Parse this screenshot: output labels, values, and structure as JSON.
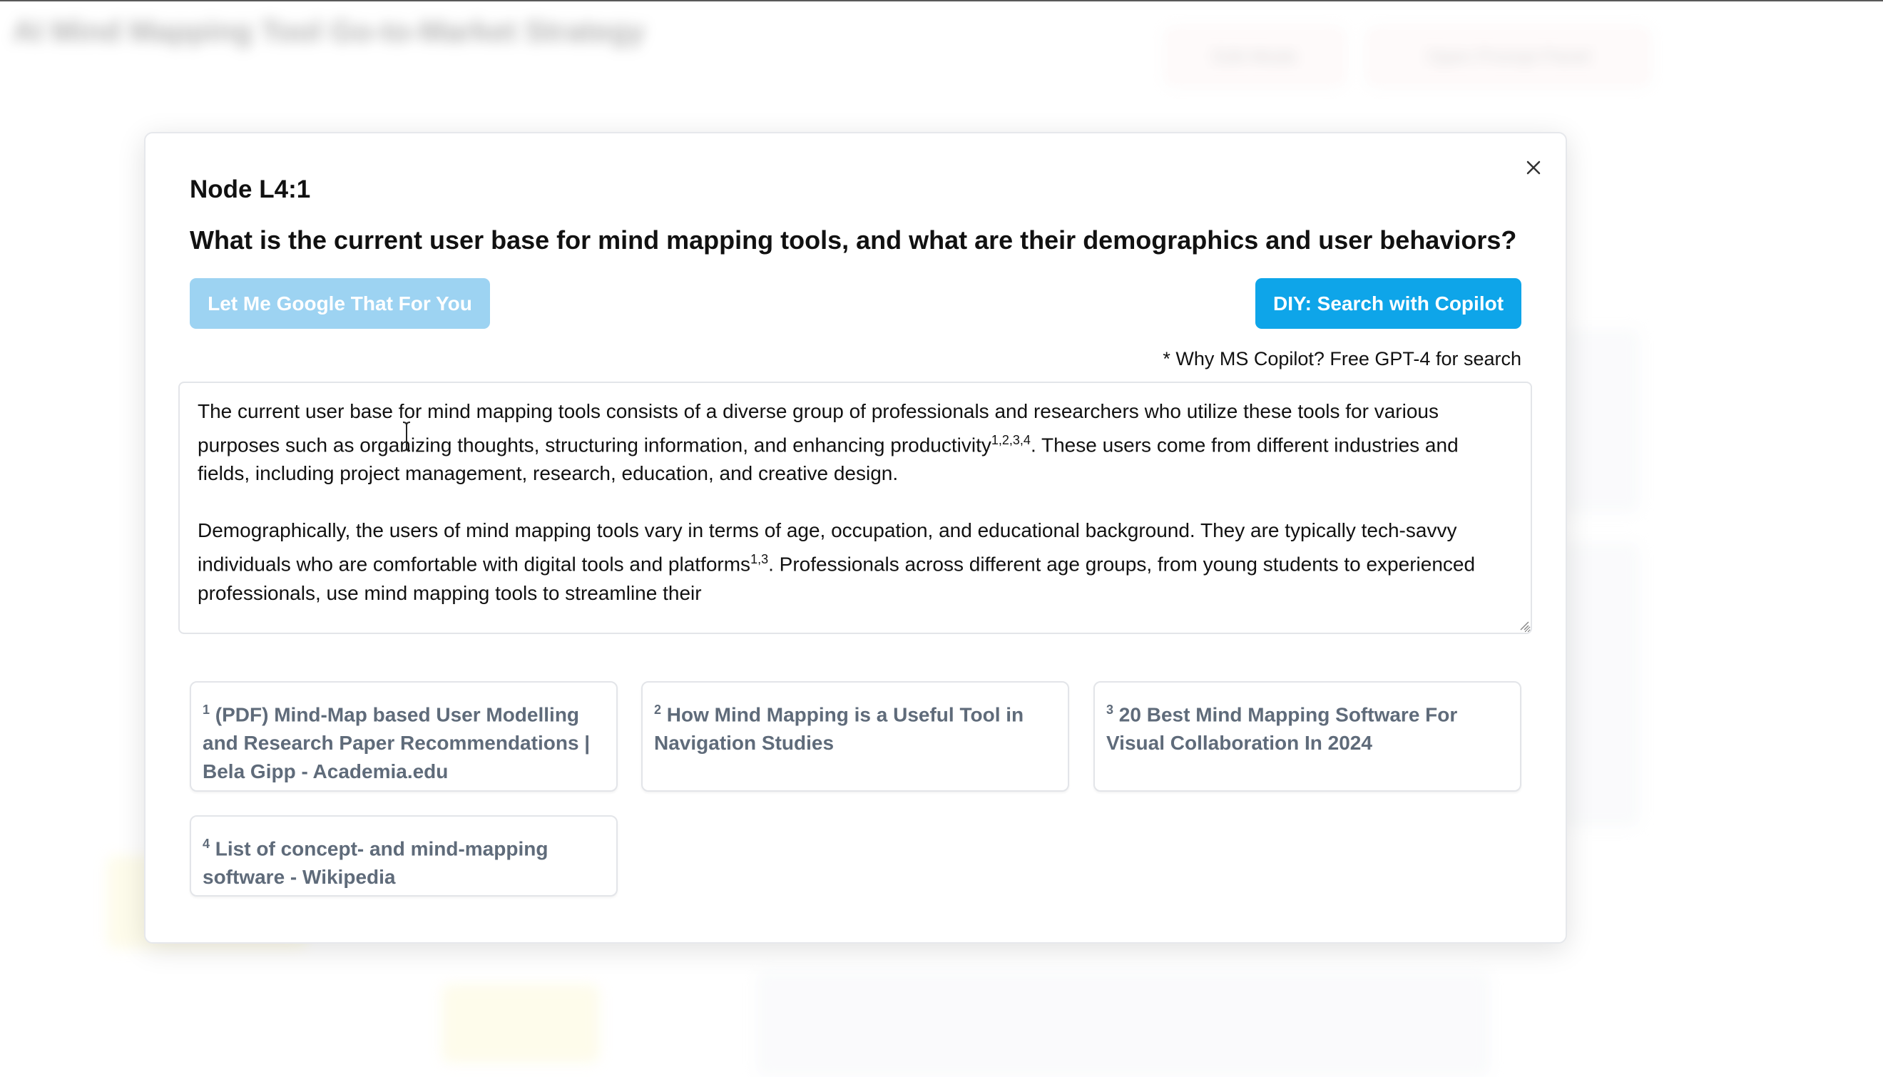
{
  "background": {
    "title": "AI Mind Mapping Tool Go-to-Market Strategy",
    "buttons": [
      "Edit Mode",
      "Open Prompt Panel"
    ]
  },
  "modal": {
    "node_title": "Node L4:1",
    "question": "What is the current user base for mind mapping tools, and what are their demographics and user behaviors?",
    "google_button": "Let Me Google That For You",
    "copilot_button": "DIY: Search with Copilot",
    "copilot_note": "* Why MS Copilot? Free GPT-4 for search",
    "answer": {
      "p1_a": "The current user base for mind mapping tools consists of a diverse group of professionals and researchers who utilize these tools for various purposes such as organizing thoughts, structuring information, and enhancing productivity",
      "p1_sup": "1,2,3,4",
      "p1_b": ". These users come from different industries and fields, including project management, research, education, and creative design.",
      "p2_a": "Demographically, the users of mind mapping tools vary in terms of age, occupation, and educational background. They are typically tech-savvy individuals who are comfortable with digital tools and platforms",
      "p2_sup": "1,3",
      "p2_b": ". Professionals across different age groups, from young students to experienced professionals, use mind mapping tools to streamline their"
    },
    "references": [
      {
        "num": "1",
        "title": "(PDF) Mind-Map based User Modelling and Research Paper Recommendations | Bela Gipp - Academia.edu"
      },
      {
        "num": "2",
        "title": "How Mind Mapping is a Useful Tool in Navigation Studies"
      },
      {
        "num": "3",
        "title": "20 Best Mind Mapping Software For Visual Collaboration In 2024"
      },
      {
        "num": "4",
        "title": "List of concept- and mind-mapping software - Wikipedia"
      }
    ]
  },
  "colors": {
    "primary": "#0ea5e9",
    "primary_light": "#9dd3f2",
    "reference_text": "#5f6b7a"
  },
  "icons": {
    "close": "close-icon",
    "resize": "resize-handle-icon",
    "cursor": "text-cursor-icon"
  }
}
